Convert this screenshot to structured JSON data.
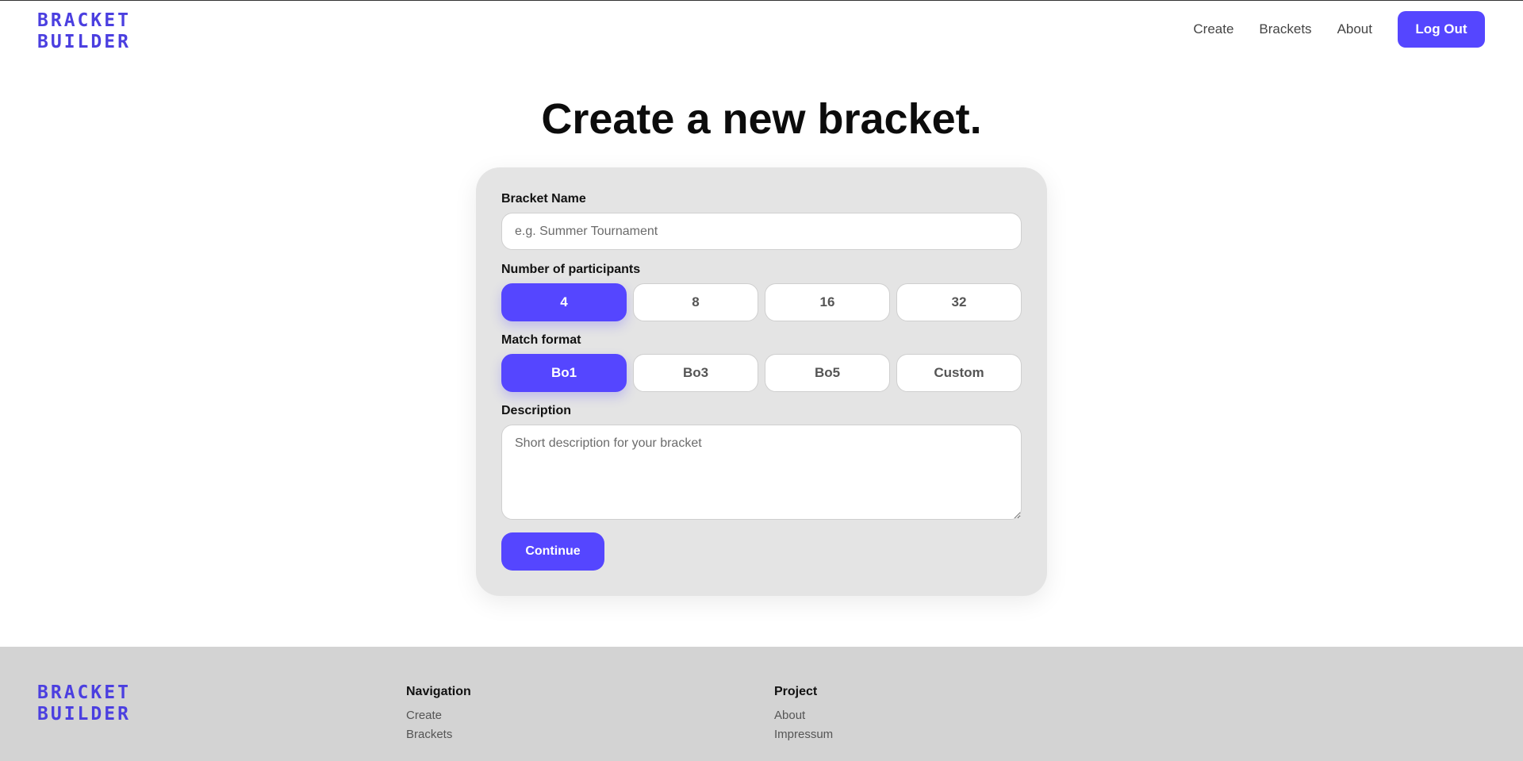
{
  "header": {
    "logo_line1": "BRACKET",
    "logo_line2": "BUILDER",
    "nav": [
      "Create",
      "Brackets",
      "About"
    ],
    "logout_label": "Log Out"
  },
  "main": {
    "title": "Create a new bracket.",
    "form": {
      "name_label": "Bracket Name",
      "name_placeholder": "e.g. Summer Tournament",
      "name_value": "",
      "participants_label": "Number of participants",
      "participants_options": [
        "4",
        "8",
        "16",
        "32"
      ],
      "participants_selected": "4",
      "format_label": "Match format",
      "format_options": [
        "Bo1",
        "Bo3",
        "Bo5",
        "Custom"
      ],
      "format_selected": "Bo1",
      "description_label": "Description",
      "description_placeholder": "Short description for your bracket",
      "continue_label": "Continue"
    }
  },
  "footer": {
    "logo_line1": "BRACKET",
    "logo_line2": "BUILDER",
    "navigation": {
      "heading": "Navigation",
      "links": [
        "Create",
        "Brackets"
      ]
    },
    "project": {
      "heading": "Project",
      "links": [
        "About",
        "Impressum"
      ]
    }
  },
  "colors": {
    "accent": "#5546ff",
    "logo": "#4b3fe0",
    "card_bg": "#e4e4e4",
    "footer_bg": "#d3d3d3"
  }
}
